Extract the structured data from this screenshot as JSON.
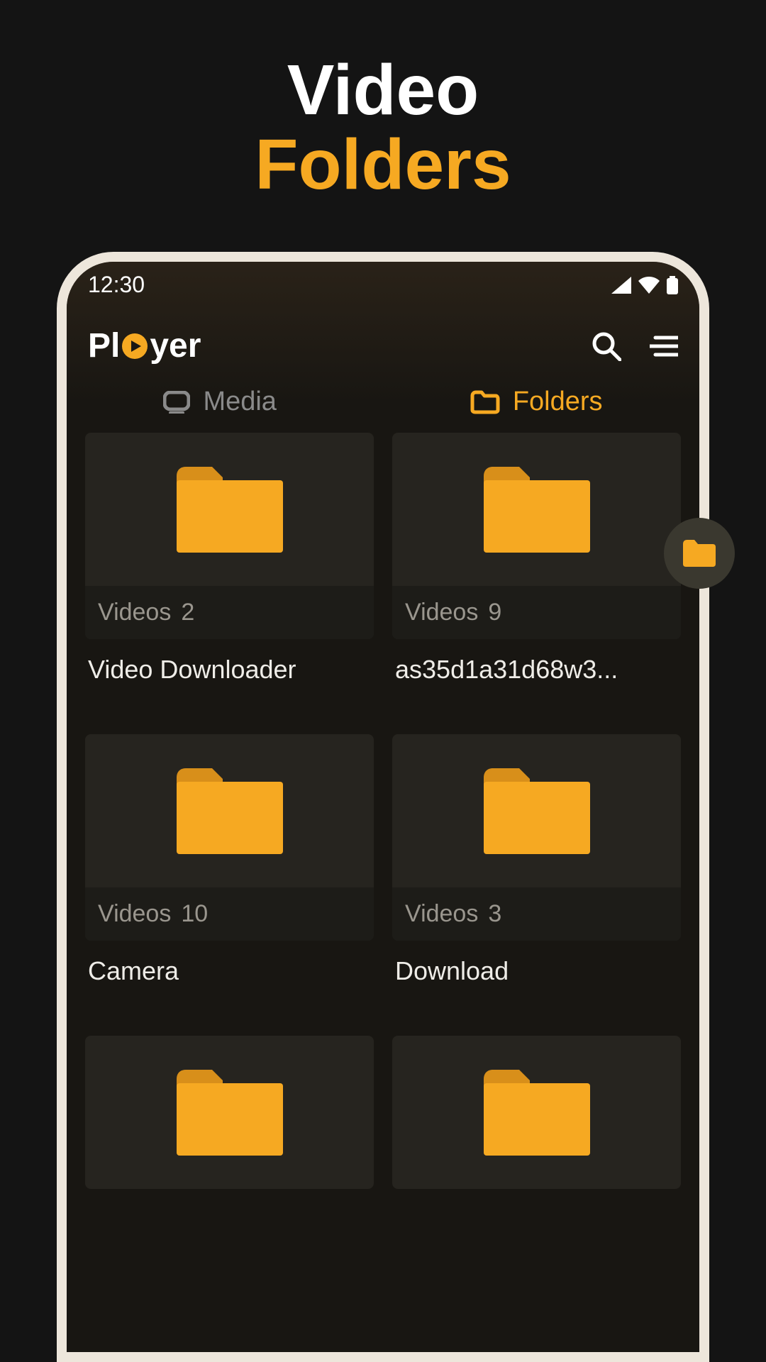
{
  "promo": {
    "line1": "Video",
    "line2": "Folders"
  },
  "status": {
    "time": "12:30"
  },
  "app": {
    "logo_prefix": "Pl",
    "logo_suffix": "yer"
  },
  "tabs": {
    "media_label": "Media",
    "folders_label": "Folders"
  },
  "meta_label": "Videos",
  "folders": [
    {
      "count": "2",
      "title": "Video Downloader"
    },
    {
      "count": "9",
      "title": "as35d1a31d68w3..."
    },
    {
      "count": "10",
      "title": "Camera"
    },
    {
      "count": "3",
      "title": "Download"
    },
    {
      "count": "",
      "title": ""
    },
    {
      "count": "",
      "title": ""
    }
  ],
  "colors": {
    "accent": "#f6a922"
  }
}
